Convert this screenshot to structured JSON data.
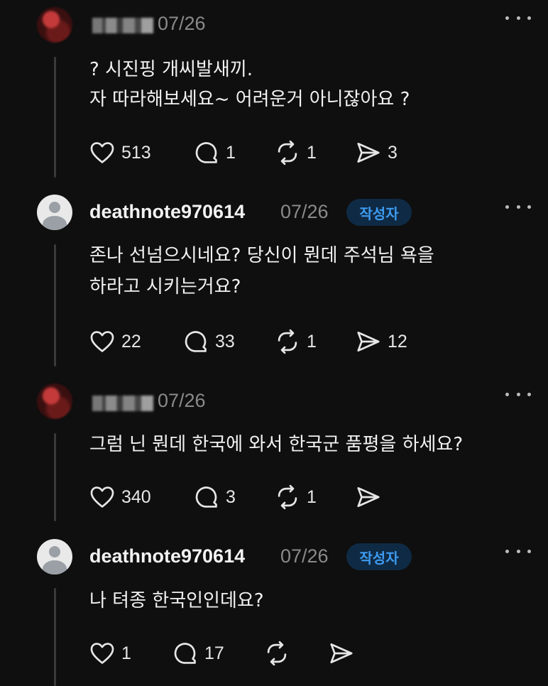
{
  "comments": [
    {
      "date": "07/26",
      "lines": [
        "? 시진핑 개씨발새끼.",
        "자 따라해보세요~ 어려운거 아니잖아요 ?"
      ],
      "likes": "513",
      "replies": "1",
      "reposts": "1",
      "shares": "3"
    },
    {
      "username": "deathnote970614",
      "date": "07/26",
      "badge": "작성자",
      "lines": [
        "존나 선넘으시네요? 당신이 뭔데 주석님 욕을",
        "하라고 시키는거요?"
      ],
      "likes": "22",
      "replies": "33",
      "reposts": "1",
      "shares": "12"
    },
    {
      "date": "07/26",
      "lines": [
        "그럼 닌 뭔데 한국에 와서 한국군 품평을 하세요?"
      ],
      "likes": "340",
      "replies": "3",
      "reposts": "1",
      "shares": ""
    },
    {
      "username": "deathnote970614",
      "date": "07/26",
      "badge": "작성자",
      "lines": [
        "나 텨종 한국인인데요?"
      ],
      "likes": "1",
      "replies": "17",
      "reposts": "",
      "shares": ""
    }
  ],
  "icons": {
    "like": "heart-icon",
    "reply": "speech-bubble-icon",
    "repost": "repost-arrows-icon",
    "share": "send-icon",
    "more": "more-dots-icon"
  }
}
